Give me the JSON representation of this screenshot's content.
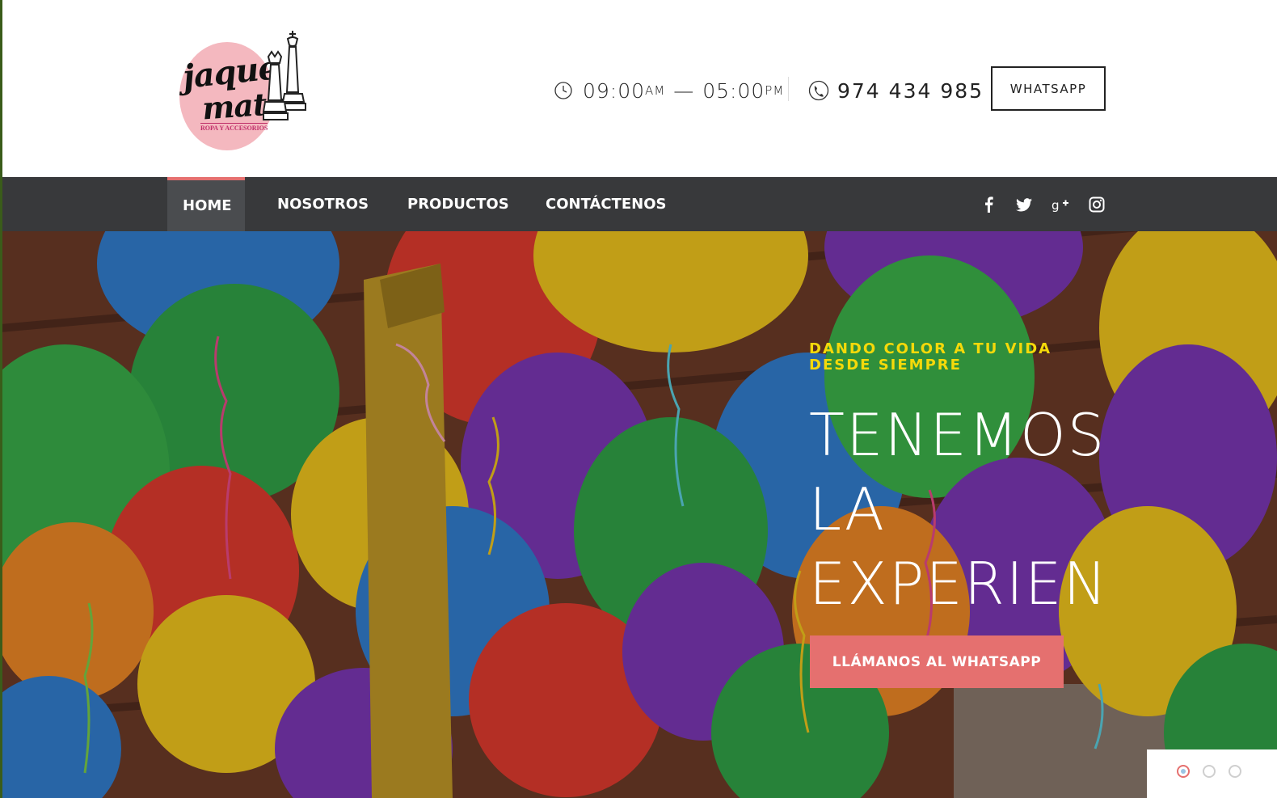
{
  "brand": {
    "logo_line1": "jaque",
    "logo_line2": "mate",
    "logo_sub": "ROPA Y ACCESORIOS",
    "logo_icon": "chess-king-queen-icon",
    "logo_pink": "#f4b8bf"
  },
  "header": {
    "hours_open": "09:00",
    "hours_open_suffix": "AM",
    "hours_dash": "—",
    "hours_close": "05:00",
    "hours_close_suffix": "PM",
    "clock_icon": "clock-icon",
    "phone_icon": "phone-icon",
    "phone": "974 434 985",
    "whatsapp_label": "WHATSAPP"
  },
  "nav": {
    "items": [
      {
        "label": "HOME",
        "active": true
      },
      {
        "label": "NOSOTROS",
        "active": false
      },
      {
        "label": "PRODUCTOS",
        "active": false
      },
      {
        "label": "CONTÁCTENOS",
        "active": false
      }
    ],
    "social": [
      "facebook-icon",
      "twitter-icon",
      "google-plus-icon",
      "instagram-icon"
    ],
    "bg_color": "#38393b",
    "accent": "#e5706f"
  },
  "hero": {
    "tagline": "DANDO COLOR A TU VIDA DESDE SIEMPRE",
    "headline": "TENEMOS\nLA\nEXPERIENCIA",
    "cta_label": "LLÁMANOS AL WHATSAPP",
    "tagline_color": "#f5d90a",
    "slides_count": 3,
    "active_slide": 1
  }
}
